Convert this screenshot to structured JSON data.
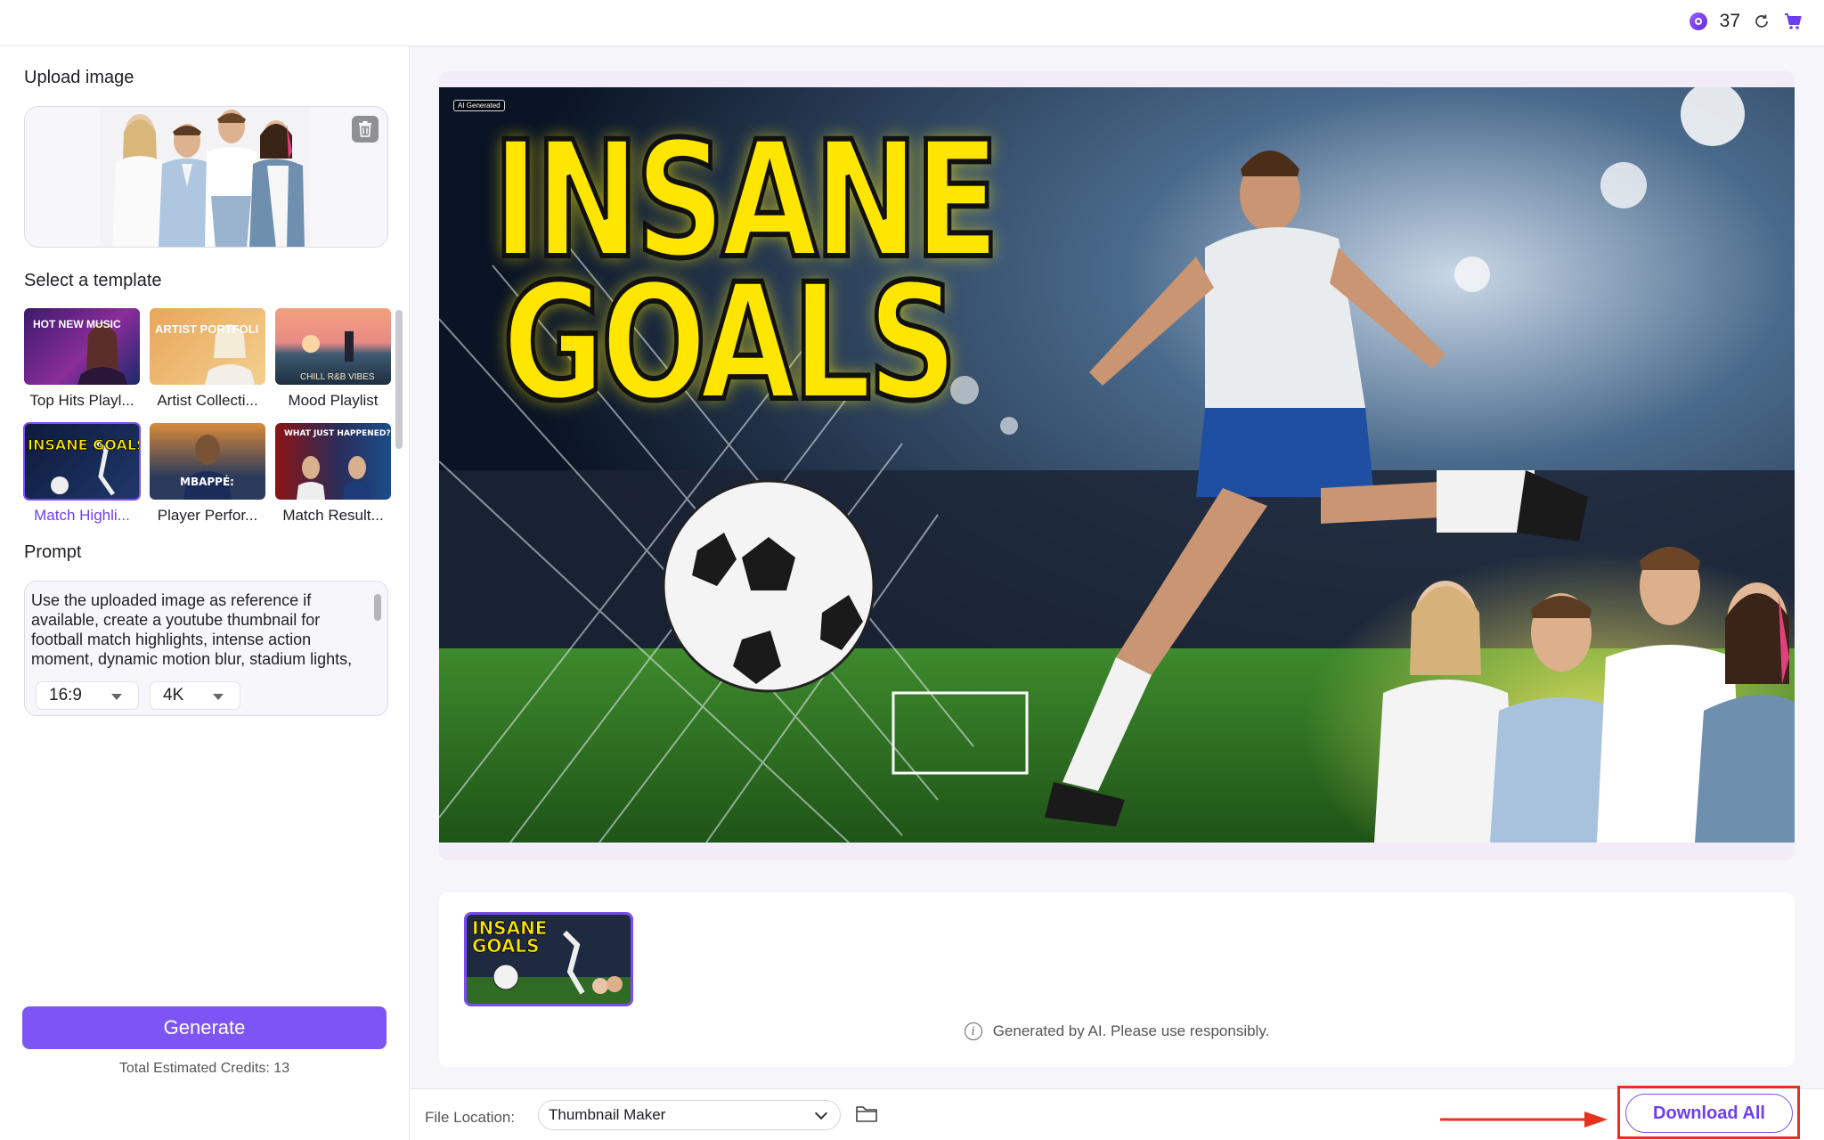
{
  "topbar": {
    "credits_count": "37",
    "coin_icon": "coin-icon",
    "refresh_icon": "refresh-icon",
    "cart_icon": "cart-icon"
  },
  "sidebar": {
    "upload_title": "Upload image",
    "template_title": "Select a template",
    "templates": [
      {
        "label": "Top Hits Playl...",
        "thumb_text": "HOT NEW MUSIC"
      },
      {
        "label": "Artist Collecti...",
        "thumb_text": "ARTIST PORTFOLI"
      },
      {
        "label": "Mood Playlist",
        "thumb_text": "CHILL R&B VIBES"
      },
      {
        "label": "Match Highli...",
        "thumb_text": "INSANE GOALS"
      },
      {
        "label": "Player Perfor...",
        "thumb_text": "MBAPPÉ:"
      },
      {
        "label": "Match Result...",
        "thumb_text": "WHAT JUST HAPPENED?!"
      }
    ],
    "selected_template_index": 3,
    "prompt_title": "Prompt",
    "prompt_text": "Use the uploaded image as reference if available, create a youtube thumbnail for football match highlights, intense action moment, dynamic motion blur, stadium lights, bold text, high contrast",
    "aspect_ratio": "16:9",
    "resolution": "4K",
    "generate_label": "Generate",
    "total_credits": "Total Estimated Credits: 13"
  },
  "preview": {
    "ai_badge": "AI Generated",
    "headline_line1": "INSANE",
    "headline_line2": "GOALS"
  },
  "gallery": {
    "thumb_line1": "INSANE",
    "thumb_line2": "GOALS",
    "notice": "Generated by AI. Please use responsibly."
  },
  "footer": {
    "file_location_label": "File Location:",
    "file_location_value": "Thumbnail Maker",
    "download_all_label": "Download All"
  },
  "colors": {
    "accent": "#7d55f5",
    "annotation_red": "#e8321e",
    "headline_yellow": "#ffe600"
  }
}
